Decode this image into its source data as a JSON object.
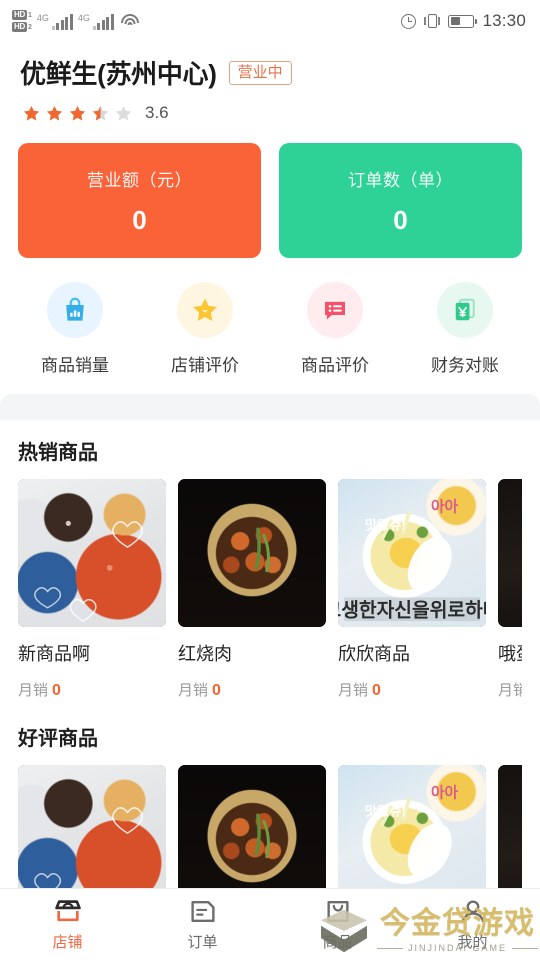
{
  "status_bar": {
    "hd_badges": [
      "HD",
      "HD"
    ],
    "network_labels": [
      "4G",
      "4G"
    ],
    "wifi_icon": "wifi-icon",
    "alarm_icon": "alarm-icon",
    "vibrate_icon": "vibrate-icon",
    "battery_icon": "battery-icon",
    "time": "13:30"
  },
  "shop": {
    "name": "优鲜生(苏州中心)",
    "status_badge": "营业中",
    "rating_value": "3.6",
    "rating_stars": 3.5,
    "star_color": "#f0682f",
    "star_empty_color": "#d8d8d8"
  },
  "stats": [
    {
      "label": "营业额（元）",
      "value": "0",
      "color": "#fa6238",
      "name": "revenue"
    },
    {
      "label": "订单数（单）",
      "value": "0",
      "color": "#2ed196",
      "name": "orders"
    }
  ],
  "quick_actions": [
    {
      "label": "商品销量",
      "icon": "shopping-bag-chart-icon",
      "icon_color": "#2fa8f5",
      "bg_color": "#e8f4ff"
    },
    {
      "label": "店铺评价",
      "icon": "star-icon",
      "icon_color": "#fcc534",
      "bg_color": "#fff6e2"
    },
    {
      "label": "商品评价",
      "icon": "comment-list-icon",
      "icon_color": "#f9506a",
      "bg_color": "#ffecef"
    },
    {
      "label": "财务对账",
      "icon": "yen-document-icon",
      "icon_color": "#2ecb8b",
      "bg_color": "#e6f8f0"
    }
  ],
  "sections": [
    {
      "title": "热销商品",
      "products": [
        {
          "name": "新商品啊",
          "sales_label": "月销",
          "sales_value": "0",
          "image": "hotpot-meal-photo"
        },
        {
          "name": "红烧肉",
          "sales_label": "月销",
          "sales_value": "0",
          "image": "braised-pork-photo"
        },
        {
          "name": "欣欣商品",
          "sales_label": "月销",
          "sales_value": "0",
          "image": "korean-noodle-soup-photo"
        },
        {
          "name": "哦蛋",
          "sales_label": "月销",
          "sales_value": "",
          "image": "dark-dish-photo"
        }
      ]
    },
    {
      "title": "好评商品",
      "products": [
        {
          "name": "",
          "sales_label": "",
          "sales_value": "",
          "image": "hotpot-meal-photo"
        },
        {
          "name": "",
          "sales_label": "",
          "sales_value": "",
          "image": "braised-pork-photo"
        },
        {
          "name": "",
          "sales_label": "",
          "sales_value": "",
          "image": "korean-noodle-soup-photo"
        },
        {
          "name": "",
          "sales_label": "",
          "sales_value": "",
          "image": "dark-dish-photo"
        }
      ]
    }
  ],
  "tabbar": {
    "active_color": "#ef6a43",
    "inactive_color": "#6d6d6d",
    "items": [
      {
        "label": "店铺",
        "icon": "storefront-icon",
        "active": true
      },
      {
        "label": "订单",
        "icon": "order-doc-icon",
        "active": false
      },
      {
        "label": "商品",
        "icon": "goods-bag-icon",
        "active": false
      },
      {
        "label": "我的",
        "icon": "person-icon",
        "active": false
      }
    ]
  },
  "watermark": {
    "main_text": "今金贷游戏",
    "sub_text": "JINJINDAI GAME",
    "color": "#d4b860"
  }
}
